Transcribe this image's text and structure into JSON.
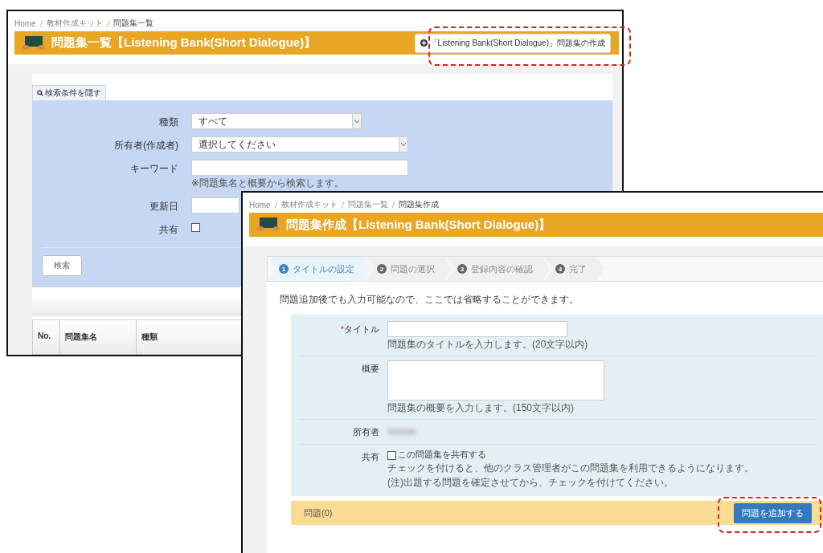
{
  "list_window": {
    "breadcrumb": [
      "Home",
      "教材作成キット",
      "問題集一覧"
    ],
    "title": "問題集一覧【Listening Bank(Short Dialogue)】",
    "create_button": {
      "label": "「Listening Bank(Short Dialogue)」問題集の作成",
      "highlighted": true
    },
    "search_toggle": "検索条件を隠す",
    "search_fields": [
      {
        "kind": "select",
        "label": "種類",
        "value": "すべて"
      },
      {
        "kind": "select",
        "label": "所有者(作成者)",
        "value": "選択してください"
      },
      {
        "kind": "text",
        "label": "キーワード",
        "hint": "※問題集名と概要から検索します。"
      },
      {
        "kind": "text",
        "label": "更新日"
      },
      {
        "kind": "checkbox",
        "label": "共有",
        "checked": false
      }
    ],
    "search_button": "検索",
    "table": {
      "columns": [
        "No.",
        "問題集名",
        "種類"
      ]
    }
  },
  "create_window": {
    "breadcrumb": [
      "Home",
      "教材作成キット",
      "問題集一覧",
      "問題集作成"
    ],
    "title": "問題集作成【Listening Bank(Short Dialogue)】",
    "steps": [
      {
        "number": "1",
        "label": "タイトルの設定",
        "selected": true
      },
      {
        "number": "2",
        "label": "問題の選択",
        "selected": false
      },
      {
        "number": "3",
        "label": "登録内容の確認",
        "selected": false
      },
      {
        "number": "4",
        "label": "完了",
        "selected": false
      }
    ],
    "note": "問題追加後でも入力可能なので、ここでは省略することができます。",
    "form_rows": [
      {
        "kind": "text",
        "label": "タイトル",
        "required_mark": "*",
        "hints": [
          "問題集のタイトルを入力します。(20文字以内)"
        ]
      },
      {
        "kind": "textarea",
        "label": "概要",
        "hints": [
          "問題集の概要を入力します。(150文字以内)"
        ]
      },
      {
        "kind": "blurred",
        "label": "所有者"
      },
      {
        "kind": "checkbox",
        "label": "共有",
        "checkbox_label": "この問題集を共有する",
        "checked": false,
        "hints": [
          "チェックを付けると、他のクラス管理者がこの問題集を利用できるようになります。",
          "(注)出題する問題を確定させてから、チェックを付けてください。"
        ]
      }
    ],
    "questions_bar": {
      "label": "問題(0)",
      "button": {
        "label": "問題を追加する",
        "highlighted": true
      }
    }
  }
}
